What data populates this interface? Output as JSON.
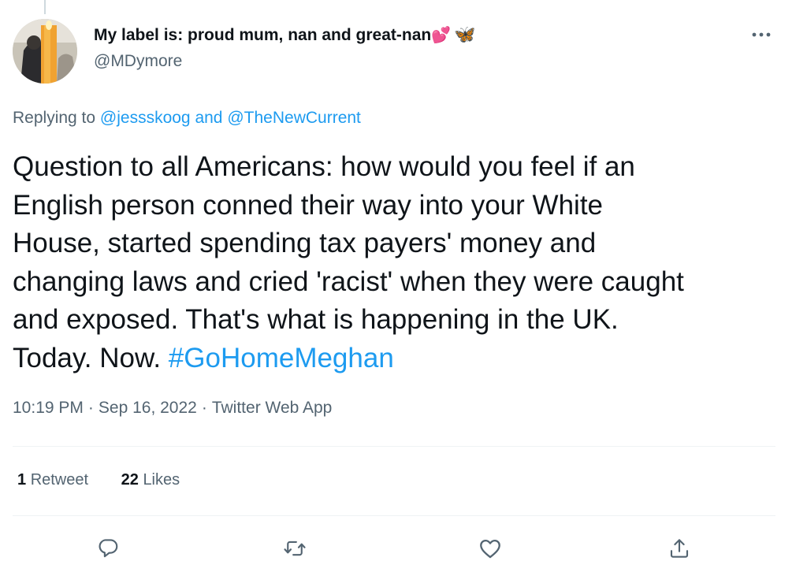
{
  "tweet": {
    "display_name": "My label is: proud mum, nan and great-nan",
    "name_emoji_hearts": "💕",
    "name_emoji_butterfly": "🦋",
    "handle": "@MDymore",
    "replying_prefix": "Replying to",
    "replying_mention_1": "@jessskoog",
    "replying_and": "and",
    "replying_mention_2": "@TheNewCurrent",
    "text_line_1": "Question to all Americans: how would you feel if an",
    "text_line_2": "English person conned their way into your White",
    "text_line_3": "House, started spending tax payers' money and",
    "text_line_4": "changing laws and cried 'racist' when they were caught",
    "text_line_5": "and exposed. That's what is happening in the UK.",
    "text_line_6": "Today. Now.",
    "hashtag": "#GoHomeMeghan",
    "time": "10:19 PM",
    "date": "Sep 16, 2022",
    "source": "Twitter Web App",
    "separator": "·",
    "retweet_count": "1",
    "retweet_label": "Retweet",
    "like_count": "22",
    "like_label": "Likes"
  },
  "icons": {
    "more": "more-icon",
    "reply": "reply-icon",
    "retweet": "retweet-icon",
    "like": "like-icon",
    "share": "share-icon"
  },
  "colors": {
    "link": "#1d9bf0",
    "secondary": "#536471",
    "primary": "#0f1419"
  }
}
